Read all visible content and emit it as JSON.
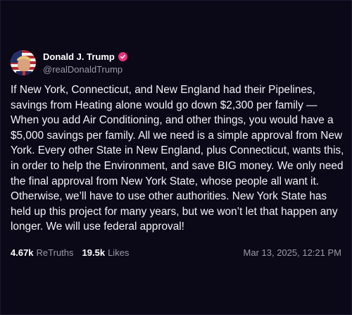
{
  "author": {
    "display_name": "Donald J. Trump",
    "handle": "@realDonaldTrump",
    "avatar_icon": "avatar-flag-portrait",
    "verified_icon": "verified-badge-icon",
    "verified_color": "#e8327a"
  },
  "post": {
    "text": "If New York, Connecticut, and New England had their Pipelines, savings from Heating alone would go down $2,300 per family — When you add Air Conditioning, and other things, you would have a $5,000 savings per family. All we need is a simple approval from New York. Every other State in New England, plus Connecticut, wants this, in order to help the Environment, and save BIG money. We only need the final approval from New York State, whose people all want it. Otherwise, we’ll have to use other authorities. New York State has held up this project for many years, but we won’t let that happen any longer. We will use federal approval!"
  },
  "stats": {
    "retruths_count": "4.67k",
    "retruths_label": "ReTruths",
    "likes_count": "19.5k",
    "likes_label": "Likes"
  },
  "timestamp": "Mar 13, 2025, 12:21 PM",
  "colors": {
    "background": "#0b0818",
    "text": "#f2f2f5",
    "muted": "#9a9aa6"
  }
}
